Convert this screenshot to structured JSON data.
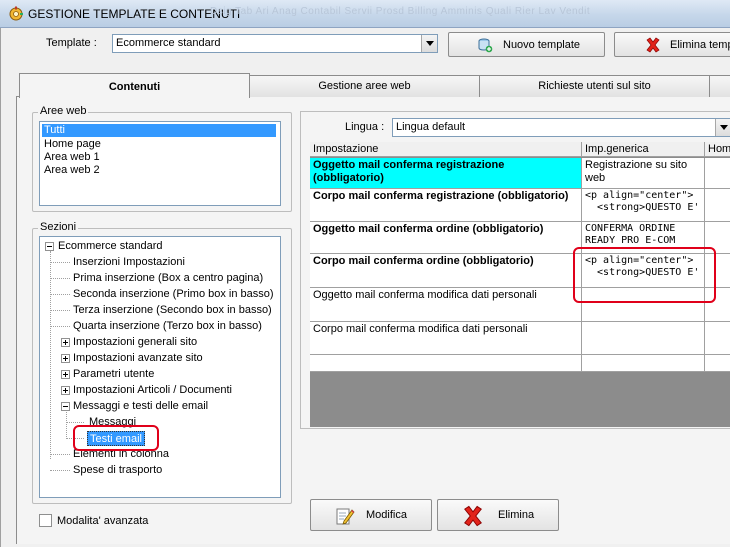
{
  "window": {
    "title": "GESTIONE TEMPLATE E CONTENUTI",
    "ghost_menu": "Dsig  Tab  Ari  Anag  Contabil  Servii  Prosd  Billing  Amminis  Quali  Rier  Lav  Vendit"
  },
  "template": {
    "label": "Template :",
    "value": "Ecommerce standard",
    "new_button": "Nuovo template",
    "delete_button": "Elimina templ"
  },
  "tabs": [
    {
      "label": "Contenuti",
      "active": true
    },
    {
      "label": "Gestione aree web",
      "active": false
    },
    {
      "label": "Richieste utenti sul sito",
      "active": false
    }
  ],
  "aree_web": {
    "title": "Aree web",
    "items": [
      "Tutti",
      "Home page",
      "Area web 1",
      "Area web 2"
    ],
    "selected": "Tutti"
  },
  "sezioni": {
    "title": "Sezioni",
    "root": "Ecommerce standard",
    "items": [
      "Inserzioni Impostazioni",
      "Prima inserzione (Box a centro pagina)",
      "Seconda inserzione (Primo box in basso)",
      "Terza inserzione (Secondo box in basso)",
      "Quarta inserzione (Terzo box in basso)",
      "Impostazioni generali sito",
      "Impostazioni avanzate sito",
      "Parametri utente",
      "Impostazioni Articoli / Documenti",
      "Messaggi e testi delle email",
      "Messaggi",
      "Testi email",
      "Elementi in colonna",
      "Spese di trasporto"
    ]
  },
  "modalita": {
    "label": "Modalita' avanzata",
    "checked": false
  },
  "lingua": {
    "label": "Lingua :",
    "value": "Lingua default"
  },
  "grid": {
    "headers": [
      "Impostazione",
      "Imp.generica",
      "Home"
    ],
    "rows": [
      {
        "setting": "Oggetto mail conferma registrazione (obbligatorio)",
        "value": "Registrazione su sito web"
      },
      {
        "setting": "Corpo mail conferma registrazione (obbligatorio)",
        "value": "<p align=\"center\">\n  <strong>QUESTO E'"
      },
      {
        "setting": "Oggetto mail conferma ordine (obbligatorio)",
        "value": "CONFERMA ORDINE READY PRO E-COM"
      },
      {
        "setting": "Corpo mail conferma ordine (obbligatorio)",
        "value": "<p align=\"center\">\n  <strong>QUESTO E'"
      },
      {
        "setting": "Oggetto mail conferma modifica dati personali",
        "value": ""
      },
      {
        "setting": "Corpo mail conferma modifica dati personali",
        "value": ""
      },
      {
        "setting": "",
        "value": ""
      }
    ]
  },
  "actions": {
    "modifica": "Modifica",
    "elimina": "Elimina"
  },
  "colors": {
    "highlight_cell": "#00ffff",
    "selection": "#3399ff",
    "annotation": "#e0001a"
  }
}
